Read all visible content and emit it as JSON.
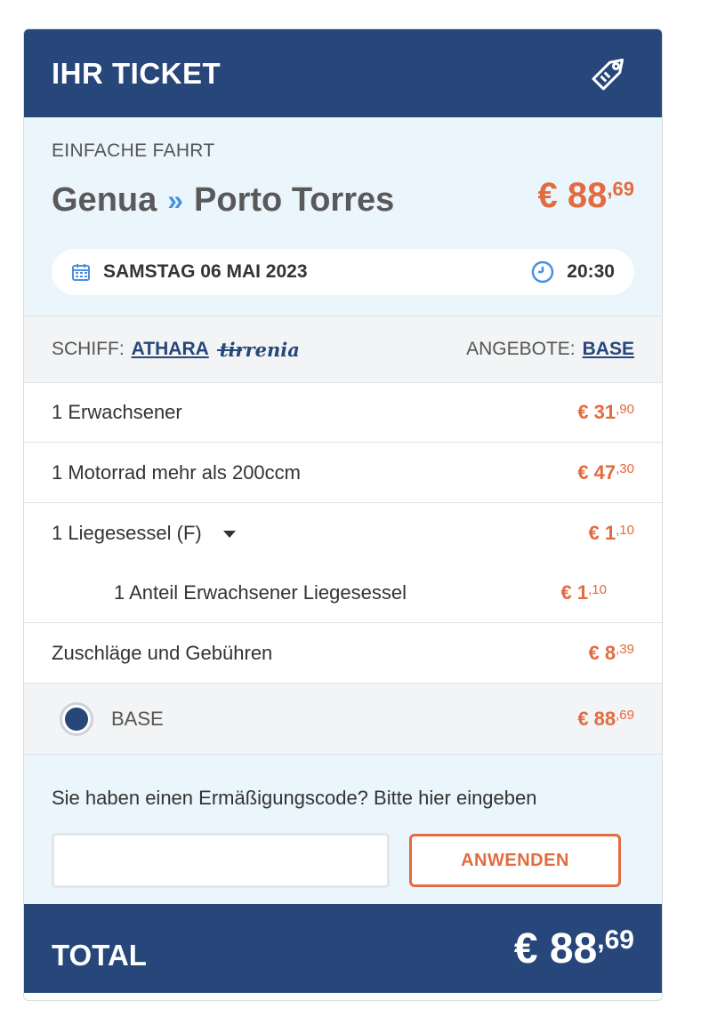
{
  "header": {
    "title": "IHR TICKET",
    "icon": "tag-icon"
  },
  "route": {
    "trip_type": "EINFACHE FAHRT",
    "from": "Genua",
    "to": "Porto Torres",
    "price_main": "€ 88",
    "price_cents": ",69",
    "date": "SAMSTAG 06 MAI 2023",
    "time": "20:30"
  },
  "ship": {
    "label": "SCHIFF:",
    "name": "ATHARA",
    "brand": "tirrenia",
    "offers_label": "ANGEBOTE:",
    "offer": "BASE"
  },
  "items": [
    {
      "label": "1 Erwachsener",
      "price_main": "€ 31",
      "price_cents": ",90"
    },
    {
      "label": "1 Motorrad mehr als 200ccm",
      "price_main": "€ 47",
      "price_cents": ",30"
    }
  ],
  "seat": {
    "label": "1 Liegesessel (F)",
    "price_main": "€ 1",
    "price_cents": ",10",
    "sub_label": "1 Anteil Erwachsener Liegesessel",
    "sub_price_main": "€ 1",
    "sub_price_cents": ",10"
  },
  "fees": {
    "label": "Zuschläge und Gebühren",
    "price_main": "€ 8",
    "price_cents": ",39"
  },
  "base_option": {
    "label": "BASE",
    "price_main": "€ 88",
    "price_cents": ",69",
    "selected": true
  },
  "promo": {
    "label": "Sie haben einen Ermäßigungscode? Bitte hier eingeben",
    "input_value": "",
    "placeholder": "",
    "button": "ANWENDEN"
  },
  "total": {
    "label": "TOTAL",
    "amount_main": "€ 88",
    "amount_cents": ",69"
  },
  "colors": {
    "primary": "#27467a",
    "accent": "#e36b3f",
    "light_bg": "#eaf5fc"
  }
}
